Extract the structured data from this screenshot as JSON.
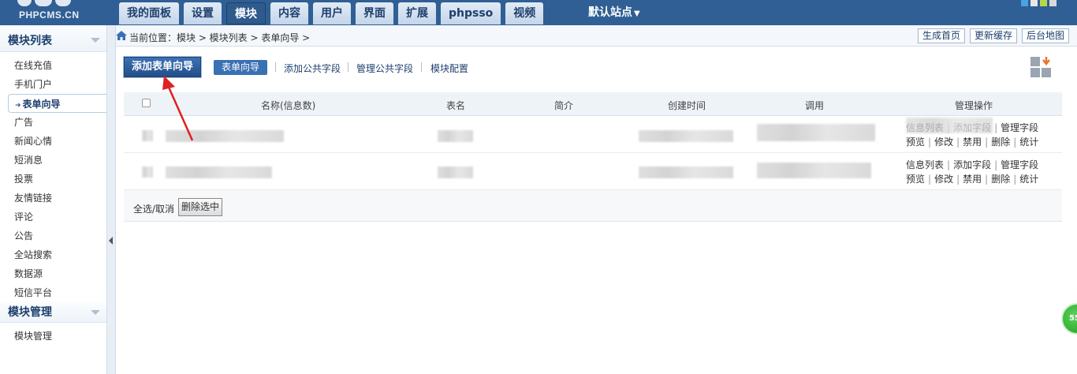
{
  "header": {
    "logo_text": "PHPCMS.CN",
    "tabs": [
      {
        "label": "我的面板"
      },
      {
        "label": "设置"
      },
      {
        "label": "模块",
        "active": true
      },
      {
        "label": "内容"
      },
      {
        "label": "用户"
      },
      {
        "label": "界面"
      },
      {
        "label": "扩展"
      },
      {
        "label": "phpsso"
      },
      {
        "label": "视频"
      }
    ],
    "site_select": "默认站点",
    "skin_colors": [
      "#4aa3df",
      "#e8e8e8",
      "#b8d84a",
      "#d9d9d9"
    ]
  },
  "sidebar": {
    "section1": "模块列表",
    "items": [
      {
        "label": "在线充值"
      },
      {
        "label": "手机门户"
      },
      {
        "label": "表单向导",
        "active": true
      },
      {
        "label": "广告"
      },
      {
        "label": "新闻心情"
      },
      {
        "label": "短消息"
      },
      {
        "label": "投票"
      },
      {
        "label": "友情链接"
      },
      {
        "label": "评论"
      },
      {
        "label": "公告"
      },
      {
        "label": "全站搜索"
      },
      {
        "label": "数据源"
      },
      {
        "label": "短信平台"
      }
    ],
    "section2": "模块管理",
    "items2": [
      {
        "label": "模块管理"
      }
    ]
  },
  "breadcrumb": {
    "text": "当前位置：模块 > 模块列表 > 表单向导 >",
    "buttons": [
      "生成首页",
      "更新缓存",
      "后台地图"
    ]
  },
  "subnav": {
    "primary": "添加表单向导",
    "secondary": "表单向导",
    "links": [
      "添加公共字段",
      "管理公共字段",
      "模块配置"
    ]
  },
  "table": {
    "headers": {
      "name": "名称(信息数)",
      "table": "表名",
      "intro": "简介",
      "created": "创建时间",
      "call": "调用",
      "ops": "管理操作"
    },
    "row_ops": {
      "line1": [
        "信息列表",
        "添加字段",
        "管理字段"
      ],
      "line2": [
        "预览",
        "修改",
        "禁用",
        "删除",
        "统计"
      ]
    },
    "footer": {
      "select_all": "全选/取消",
      "delete_selected": "删除选中"
    }
  },
  "badge": "55"
}
